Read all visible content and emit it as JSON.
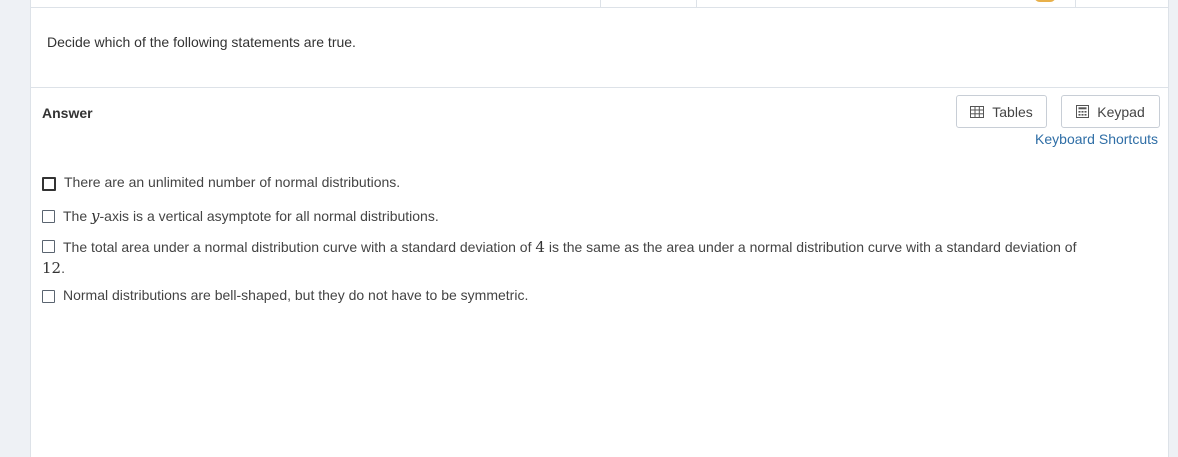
{
  "question": {
    "prompt": "Decide which of the following statements are true."
  },
  "answer": {
    "label": "Answer",
    "tables_label": "Tables",
    "keypad_label": "Keypad",
    "shortcuts_label": "Keyboard Shortcuts"
  },
  "options": [
    {
      "text": "There are an unlimited number of normal distributions."
    },
    {
      "pre": "The ",
      "math": "y",
      "post": "-axis is a vertical asymptote for all normal distributions."
    },
    {
      "pre": "The total area under a normal distribution curve with a standard deviation of ",
      "math1": "4",
      "mid": " is the same as the area under a normal distribution curve with a standard deviation of ",
      "math2": "12",
      "post": "."
    },
    {
      "text": "Normal distributions are bell-shaped, but they do not have to be symmetric."
    }
  ],
  "colors": {
    "link": "#2f6ea6",
    "border": "#dde2e8",
    "background": "#eef1f5"
  }
}
